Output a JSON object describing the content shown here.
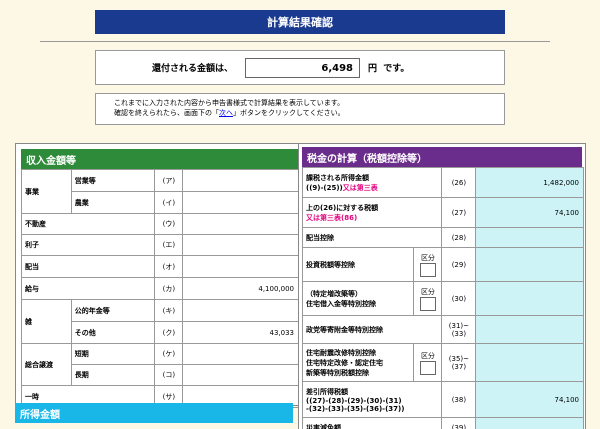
{
  "title": "計算結果確認",
  "refund": {
    "label": "還付される金額は、",
    "amount": "6,498",
    "unit": "円",
    "suffix": "です。"
  },
  "info": {
    "line1": "これまでに入力された内容から申告書様式で計算結果を表示しています。",
    "line2_pre": "確認を終えられたら、画面下の「",
    "link": "次へ",
    "line2_post": "」ボタンをクリックしてください。"
  },
  "left": {
    "header": "収入金額等",
    "rows": {
      "jigyo": "事業",
      "eigyo": "営業等",
      "eigyo_code": "(ア)",
      "nogyo": "農業",
      "nogyo_code": "(イ)",
      "fudosan": "不動産",
      "fudosan_code": "(ウ)",
      "rishi": "利子",
      "rishi_code": "(エ)",
      "haito": "配当",
      "haito_code": "(オ)",
      "kyuyo": "給与",
      "kyuyo_code": "(カ)",
      "kyuyo_value": "4,100,000",
      "zatsu": "雑",
      "nenkin": "公的年金等",
      "nenkin_code": "(キ)",
      "sonota": "その他",
      "sonota_code": "(ク)",
      "sonota_value": "43,033",
      "sogo": "総合譲渡",
      "tanki": "短期",
      "tanki_code": "(ケ)",
      "choki": "長期",
      "choki_code": "(コ)",
      "ichiji": "一時",
      "ichiji_code": "(サ)"
    }
  },
  "income_header": "所得金額",
  "right": {
    "header": "税金の計算（税額控除等）",
    "kubun": "区分",
    "r26_a": "課税される所得金額",
    "r26_b": "((9)-(25))",
    "r26_red": "又は第三表",
    "r26_code": "(26)",
    "r26_value": "1,482,000",
    "r27_a": "上の(26)に対する税額",
    "r27_red": "又は第三表(86)",
    "r27_code": "(27)",
    "r27_value": "74,100",
    "r28_label": "配当控除",
    "r28_code": "(28)",
    "r29_label": "投資税額等控除",
    "r29_code": "(29)",
    "r30_a": "（特定増改築等）",
    "r30_b": "住宅借入金等特別控除",
    "r30_code": "(30)",
    "r31_label": "政党等寄附金等特別控除",
    "r31_code_a": "(31)~",
    "r31_code_b": "(33)",
    "r35_a": "住宅耐震改修特別控除",
    "r35_b": "住宅特定改修・認定住宅",
    "r35_c": "新築等特別税額控除",
    "r35_code_a": "(35)~",
    "r35_code_b": "(37)",
    "r38_a": "差引所得税額",
    "r38_b": "((27)-(28)-(29)-(30)-(31)",
    "r38_c": "-(32)-(33)-(35)-(36)-(37))",
    "r38_code": "(38)",
    "r38_value": "74,100",
    "r39_label": "災害減免額",
    "r39_code": "(39)"
  },
  "colors": {
    "title_bg": "#1a3a8f",
    "left_header_bg": "#2e8b3a",
    "right_header_bg": "#6b2d8b",
    "income_header_bg": "#18b7e8",
    "value_cell_bg": "#cdf3f7",
    "red_note": "#e4007f",
    "page_bg": "#fdf8e6"
  }
}
